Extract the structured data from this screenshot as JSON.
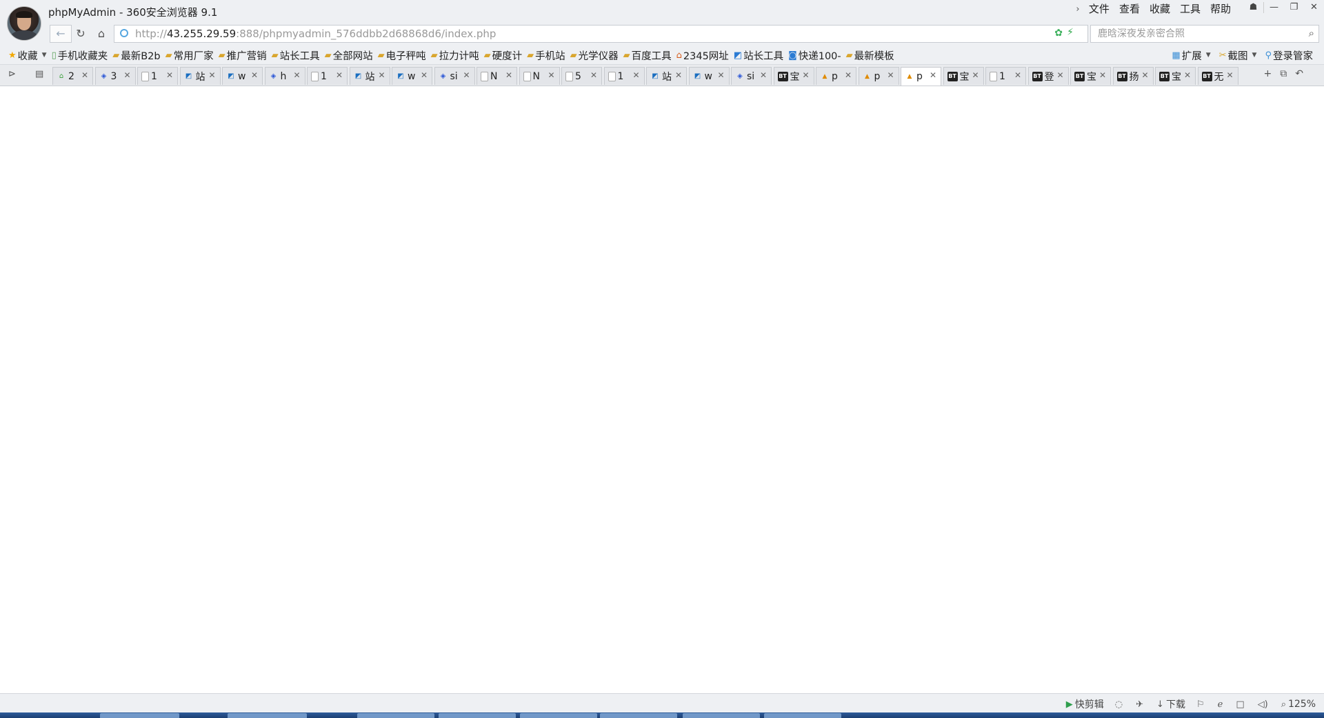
{
  "window": {
    "title": "phpMyAdmin - 360安全浏览器 9.1",
    "menu": [
      "文件",
      "查看",
      "收藏",
      "工具",
      "帮助"
    ]
  },
  "address": {
    "url_scheme": "http://",
    "url_host": "43.255.29.59",
    "url_rest": ":888/phpmyadmin_576ddbb2d68868d6/index.php",
    "search_placeholder": "鹿晗深夜发亲密合照"
  },
  "bookmarks": {
    "favorites_label": "收藏",
    "items": [
      {
        "label": "手机收藏夹",
        "icon": "phone-icon"
      },
      {
        "label": "最新B2b",
        "icon": "folder-icon"
      },
      {
        "label": "常用厂家",
        "icon": "folder-icon"
      },
      {
        "label": "推广营销",
        "icon": "folder-icon"
      },
      {
        "label": "站长工具",
        "icon": "folder-icon"
      },
      {
        "label": "全部网站",
        "icon": "folder-icon"
      },
      {
        "label": "电子秤吨",
        "icon": "folder-icon"
      },
      {
        "label": "拉力计吨",
        "icon": "folder-icon"
      },
      {
        "label": "硬度计",
        "icon": "folder-icon"
      },
      {
        "label": "手机站",
        "icon": "folder-icon"
      },
      {
        "label": "光学仪器",
        "icon": "folder-icon"
      },
      {
        "label": "百度工具",
        "icon": "folder-icon"
      },
      {
        "label": "2345网址",
        "icon": "2345-icon"
      },
      {
        "label": "站长工具",
        "icon": "site-icon"
      },
      {
        "label": "快递100-",
        "icon": "kuaidi-icon"
      },
      {
        "label": "最新模板",
        "icon": "folder-icon"
      }
    ],
    "right": [
      {
        "label": "扩展",
        "icon": "extension-icon"
      },
      {
        "label": "截图",
        "icon": "screenshot-icon"
      },
      {
        "label": "登录管家",
        "icon": "login-manager-icon"
      }
    ]
  },
  "tabs": [
    {
      "label": "2",
      "icon": "green"
    },
    {
      "label": "3",
      "icon": "baidu"
    },
    {
      "label": "1",
      "icon": "page"
    },
    {
      "label": "站",
      "icon": "site"
    },
    {
      "label": "w",
      "icon": "site"
    },
    {
      "label": "h",
      "icon": "baidu"
    },
    {
      "label": "1",
      "icon": "page"
    },
    {
      "label": "站",
      "icon": "site"
    },
    {
      "label": "w",
      "icon": "site"
    },
    {
      "label": "si",
      "icon": "baidu"
    },
    {
      "label": "N",
      "icon": "page"
    },
    {
      "label": "N",
      "icon": "page"
    },
    {
      "label": "5",
      "icon": "page"
    },
    {
      "label": "1",
      "icon": "page"
    },
    {
      "label": "站",
      "icon": "site"
    },
    {
      "label": "w",
      "icon": "site"
    },
    {
      "label": "si",
      "icon": "baidu"
    },
    {
      "label": "宝",
      "icon": "bt"
    },
    {
      "label": "p",
      "icon": "pma"
    },
    {
      "label": "p",
      "icon": "pma"
    },
    {
      "label": "p",
      "icon": "pma",
      "active": true
    },
    {
      "label": "宝",
      "icon": "bt"
    },
    {
      "label": "1",
      "icon": "page"
    },
    {
      "label": "登",
      "icon": "bt"
    },
    {
      "label": "宝",
      "icon": "bt"
    },
    {
      "label": "扬",
      "icon": "bt"
    },
    {
      "label": "宝",
      "icon": "bt"
    },
    {
      "label": "无",
      "icon": "bt"
    }
  ],
  "status": {
    "quick_clip": "快剪辑",
    "download": "下载",
    "zoom": "125%"
  }
}
